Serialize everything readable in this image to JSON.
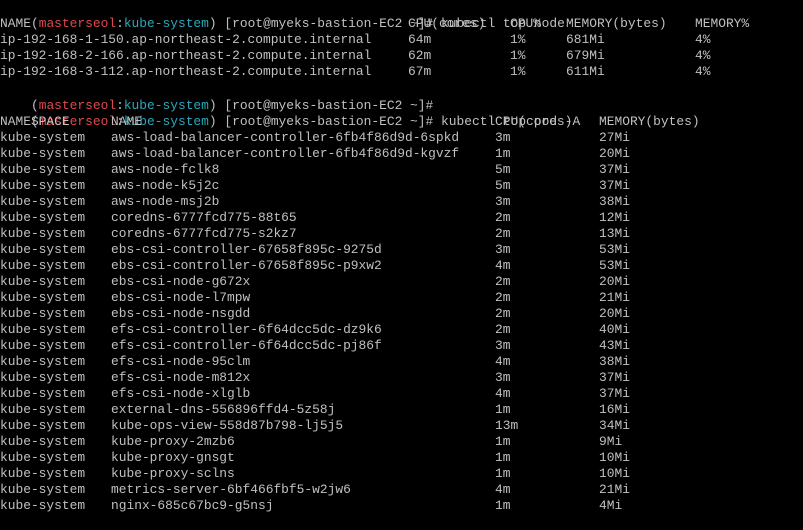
{
  "prompt": {
    "open_paren": "(",
    "user_host": "masterseol",
    "colon": ":",
    "context": "kube-system",
    "close_paren": ")",
    "shell": "[root@myeks-bastion-EC2 ~]#"
  },
  "commands": {
    "top_node": "kubectl top node",
    "top_pod": "kubectl top pod -A",
    "last": ""
  },
  "colors": {
    "prompt_user": "#e0474e",
    "prompt_context": "#2aa8b8",
    "text": "#c0c0c0",
    "background": "#000000"
  },
  "node_table": {
    "headers": [
      "NAME",
      "CPU(cores)",
      "CPU%",
      "MEMORY(bytes)",
      "MEMORY%"
    ],
    "rows": [
      [
        "ip-192-168-1-150.ap-northeast-2.compute.internal",
        "64m",
        "1%",
        "681Mi",
        "4%"
      ],
      [
        "ip-192-168-2-166.ap-northeast-2.compute.internal",
        "62m",
        "1%",
        "679Mi",
        "4%"
      ],
      [
        "ip-192-168-3-112.ap-northeast-2.compute.internal",
        "67m",
        "1%",
        "611Mi",
        "4%"
      ]
    ]
  },
  "pod_table": {
    "headers": [
      "NAMESPACE",
      "NAME",
      "CPU(cores)",
      "MEMORY(bytes)"
    ],
    "rows": [
      [
        "kube-system",
        "aws-load-balancer-controller-6fb4f86d9d-6spkd",
        "3m",
        "27Mi"
      ],
      [
        "kube-system",
        "aws-load-balancer-controller-6fb4f86d9d-kgvzf",
        "1m",
        "20Mi"
      ],
      [
        "kube-system",
        "aws-node-fclk8",
        "5m",
        "37Mi"
      ],
      [
        "kube-system",
        "aws-node-k5j2c",
        "5m",
        "37Mi"
      ],
      [
        "kube-system",
        "aws-node-msj2b",
        "3m",
        "38Mi"
      ],
      [
        "kube-system",
        "coredns-6777fcd775-88t65",
        "2m",
        "12Mi"
      ],
      [
        "kube-system",
        "coredns-6777fcd775-s2kz7",
        "2m",
        "13Mi"
      ],
      [
        "kube-system",
        "ebs-csi-controller-67658f895c-9275d",
        "3m",
        "53Mi"
      ],
      [
        "kube-system",
        "ebs-csi-controller-67658f895c-p9xw2",
        "4m",
        "53Mi"
      ],
      [
        "kube-system",
        "ebs-csi-node-g672x",
        "2m",
        "20Mi"
      ],
      [
        "kube-system",
        "ebs-csi-node-l7mpw",
        "2m",
        "21Mi"
      ],
      [
        "kube-system",
        "ebs-csi-node-nsgdd",
        "2m",
        "20Mi"
      ],
      [
        "kube-system",
        "efs-csi-controller-6f64dcc5dc-dz9k6",
        "2m",
        "40Mi"
      ],
      [
        "kube-system",
        "efs-csi-controller-6f64dcc5dc-pj86f",
        "3m",
        "43Mi"
      ],
      [
        "kube-system",
        "efs-csi-node-95clm",
        "4m",
        "38Mi"
      ],
      [
        "kube-system",
        "efs-csi-node-m812x",
        "3m",
        "37Mi"
      ],
      [
        "kube-system",
        "efs-csi-node-xlglb",
        "4m",
        "37Mi"
      ],
      [
        "kube-system",
        "external-dns-556896ffd4-5z58j",
        "1m",
        "16Mi"
      ],
      [
        "kube-system",
        "kube-ops-view-558d87b798-lj5j5",
        "13m",
        "34Mi"
      ],
      [
        "kube-system",
        "kube-proxy-2mzb6",
        "1m",
        "9Mi"
      ],
      [
        "kube-system",
        "kube-proxy-gnsgt",
        "1m",
        "10Mi"
      ],
      [
        "kube-system",
        "kube-proxy-sclns",
        "1m",
        "10Mi"
      ],
      [
        "kube-system",
        "metrics-server-6bf466fbf5-w2jw6",
        "4m",
        "21Mi"
      ],
      [
        "kube-system",
        "nginx-685c67bc9-g5nsj",
        "1m",
        "4Mi"
      ]
    ]
  }
}
